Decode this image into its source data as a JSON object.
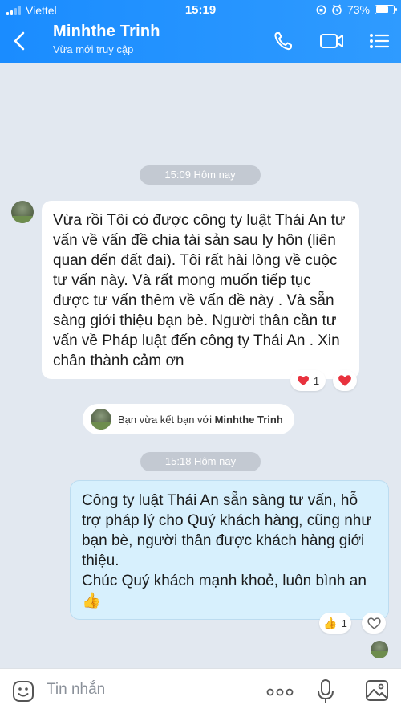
{
  "status_bar": {
    "carrier": "Viettel",
    "time": "15:19",
    "battery": "73%",
    "battery_level": 0.73
  },
  "header": {
    "title": "Minhthe Trinh",
    "subtitle": "Vừa mới truy cập"
  },
  "chat": {
    "time_1": "15:09 Hôm nay",
    "incoming_message": "Vừa rồi Tôi có được công ty luật Thái An tư vấn về vấn đề chia tài sản sau ly hôn (liên quan đến đất đai). Tôi rất hài lòng về cuộc tư vấn này.  Và rất mong muốn tiếp tục được tư vấn thêm về vấn đề này . Và sẵn sàng giới thiệu  bạn bè.  Người thân cần tư vấn về Pháp luật đến công ty Thái An . Xin chân thành cảm ơn",
    "incoming_reaction_count": "1",
    "system_prefix": "Bạn vừa kết bạn với",
    "system_name": "Minhthe Trinh",
    "time_2": "15:18 Hôm nay",
    "outgoing_message_line1": "Công ty luật Thái An sẵn sàng tư vấn, hỗ trợ pháp lý cho Quý khách hàng, cũng như bạn bè, người thân được khách hàng giới thiệu.",
    "outgoing_message_line2": "Chúc Quý khách mạnh khoẻ, luôn bình an",
    "outgoing_reaction_count": "1"
  },
  "composer": {
    "placeholder": "Tin nhắn"
  },
  "icons": [
    "back-chevron-icon",
    "phone-icon",
    "video-call-icon",
    "menu-list-icon",
    "heart-icon",
    "thumbs-up-icon",
    "sticker-icon",
    "more-icon",
    "microphone-icon",
    "image-icon"
  ],
  "colors": {
    "header_start": "#1a8cff",
    "header_end": "#2f9bff",
    "background": "#e2e8f0",
    "outgoing_bubble": "#d7f0fd",
    "heart": "#e8323e"
  }
}
